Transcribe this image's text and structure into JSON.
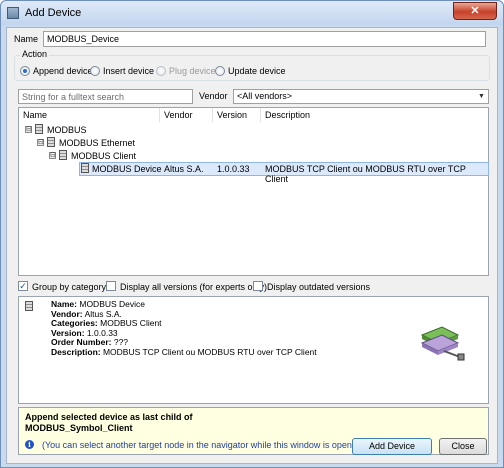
{
  "window": {
    "title": "Add Device"
  },
  "name_field": {
    "label": "Name",
    "value": "MODBUS_Device"
  },
  "action": {
    "label": "Action",
    "options": [
      {
        "label": "Append device",
        "selected": true,
        "enabled": true
      },
      {
        "label": "Insert device",
        "selected": false,
        "enabled": true
      },
      {
        "label": "Plug device",
        "selected": false,
        "enabled": false
      },
      {
        "label": "Update device",
        "selected": false,
        "enabled": true
      }
    ]
  },
  "search": {
    "placeholder": "String for a fulltext search"
  },
  "vendor": {
    "label": "Vendor",
    "selected": "<All vendors>"
  },
  "device_list": {
    "columns": [
      "Name",
      "Vendor",
      "Version",
      "Description"
    ],
    "tree": [
      {
        "name": "MODBUS",
        "expander": "⊟"
      },
      {
        "name": "MODBUS Ethernet",
        "expander": "⊟"
      },
      {
        "name": "MODBUS Client",
        "expander": "⊟"
      },
      {
        "name": "MODBUS Device",
        "vendor": "Altus S.A.",
        "version": "1.0.0.33",
        "description": "MODBUS TCP Client ou MODBUS RTU over TCP Client",
        "selected": true
      }
    ]
  },
  "options": [
    {
      "label": "Group by category",
      "checked": true
    },
    {
      "label": "Display all versions (for experts only)",
      "checked": false
    },
    {
      "label": "Display outdated versions",
      "checked": false
    }
  ],
  "details": {
    "name_label": "Name:",
    "name": "MODBUS Device",
    "vendor_label": "Vendor:",
    "vendor": "Altus S.A.",
    "categories_label": "Categories:",
    "categories": "MODBUS Client",
    "version_label": "Version:",
    "version": "1.0.0.33",
    "order_label": "Order Number:",
    "order": "???",
    "description_label": "Description:",
    "description": "MODBUS TCP Client ou MODBUS RTU over TCP Client"
  },
  "message": {
    "line1": "Append selected device as last child of",
    "line2": "MODBUS_Symbol_Client",
    "hint": "(You can select another target node in the navigator while this window is open.)"
  },
  "buttons": {
    "add": "Add Device",
    "close": "Close"
  },
  "icons": [
    "device-icon",
    "close-icon",
    "info-icon",
    "device-image"
  ],
  "colors": {
    "title_bar": "#c2d5ee",
    "selection": "#dbe9fb",
    "message_bg": "#ffffe1",
    "info_icon": "#1f4fc9"
  }
}
